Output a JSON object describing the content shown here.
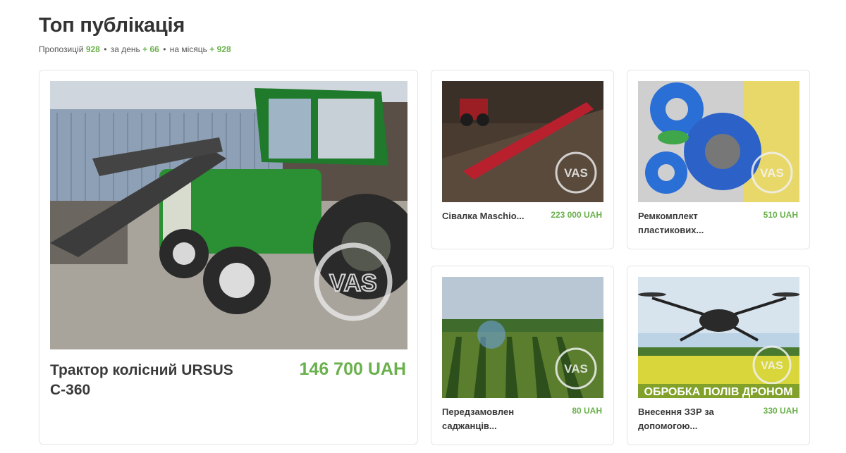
{
  "section": {
    "title": "Топ публікація",
    "stats": {
      "offers_label": "Пропозицій",
      "offers_value": "928",
      "day_label": "за день",
      "day_value": "+ 66",
      "month_label": "на місяць",
      "month_value": "+ 928"
    }
  },
  "listings": [
    {
      "name": "Трактор колісний URSUS C-360",
      "price": "146 700 UAH",
      "watermark": "VAS"
    },
    {
      "name": "Сівалка Maschio...",
      "price": "223 000 UAH",
      "watermark": "VAS"
    },
    {
      "name": "Ремкомплект пластикових...",
      "price": "510 UAH",
      "watermark": "VAS"
    },
    {
      "name": "Передзамовлен саджанців...",
      "price": "80 UAH",
      "watermark": "VAS"
    },
    {
      "name": "Внесення ЗЗР за допомогою...",
      "price": "330 UAH",
      "watermark": "VAS",
      "banner": "ОБРОБКА ПОЛІВ ДРОНОМ"
    }
  ],
  "colors": {
    "accent": "#6ab04c",
    "text": "#333333",
    "border": "#e6e6e6"
  }
}
